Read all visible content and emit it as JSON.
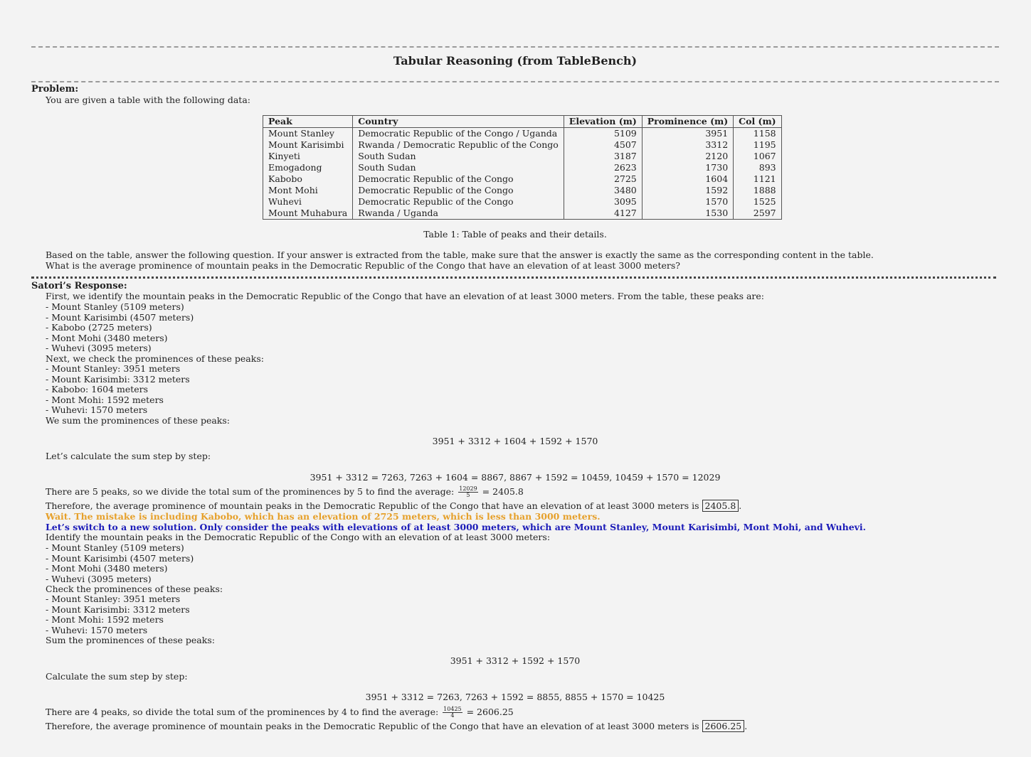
{
  "title": "Tabular Reasoning (from TableBench)",
  "problem": {
    "heading": "Problem:",
    "intro": "You are given a table with the following data:",
    "table": {
      "headers": [
        "Peak",
        "Country",
        "Elevation (m)",
        "Prominence (m)",
        "Col (m)"
      ],
      "rows": [
        [
          "Mount Stanley",
          "Democratic Republic of the Congo / Uganda",
          "5109",
          "3951",
          "1158"
        ],
        [
          "Mount Karisimbi",
          "Rwanda / Democratic Republic of the Congo",
          "4507",
          "3312",
          "1195"
        ],
        [
          "Kinyeti",
          "South Sudan",
          "3187",
          "2120",
          "1067"
        ],
        [
          "Emogadong",
          "South Sudan",
          "2623",
          "1730",
          "893"
        ],
        [
          "Kabobo",
          "Democratic Republic of the Congo",
          "2725",
          "1604",
          "1121"
        ],
        [
          "Mont Mohi",
          "Democratic Republic of the Congo",
          "3480",
          "1592",
          "1888"
        ],
        [
          "Wuhevi",
          "Democratic Republic of the Congo",
          "3095",
          "1570",
          "1525"
        ],
        [
          "Mount Muhabura",
          "Rwanda / Uganda",
          "4127",
          "1530",
          "2597"
        ]
      ],
      "caption": "Table 1: Table of peaks and their details."
    },
    "instruction": "Based on the table, answer the following question. If your answer is extracted from the table, make sure that the answer is exactly the same as the corresponding content in the table.",
    "question": "What is the average prominence of mountain peaks in the Democratic Republic of the Congo that have an elevation of at least 3000 meters?"
  },
  "response": {
    "heading": "Satori’s Response:",
    "first": "First, we identify the mountain peaks in the Democratic Republic of the Congo that have an elevation of at least 3000 meters. From the table, these peaks are:",
    "list1": [
      "- Mount Stanley (5109 meters)",
      "- Mount Karisimbi (4507 meters)",
      "- Kabobo (2725 meters)",
      "- Mont Mohi (3480 meters)",
      "- Wuhevi (3095 meters)"
    ],
    "next": "Next, we check the prominences of these peaks:",
    "list2": [
      "- Mount Stanley: 3951 meters",
      "- Mount Karisimbi: 3312 meters",
      "- Kabobo: 1604 meters",
      "- Mont Mohi: 1592 meters",
      "- Wuhevi: 1570 meters"
    ],
    "sum_intro": "We sum the prominences of these peaks:",
    "eq1": "3951 + 3312 + 1604 + 1592 + 1570",
    "step_intro": "Let’s calculate the sum step by step:",
    "eq2": "3951 + 3312 = 7263, 7263 + 1604 = 8867, 8867 + 1592 = 10459, 10459 + 1570 = 12029",
    "avg_text": "There are 5 peaks, so we divide the total sum of the prominences by 5 to find the average:",
    "avg_num": "12029",
    "avg_den": "5",
    "avg_result": "= 2405.8",
    "therefore1": "Therefore, the average prominence of mountain peaks in the Democratic Republic of the Congo that have an elevation of at least 3000 meters is",
    "answer1": "2405.8",
    "wait": "Wait. The mistake is including Kabobo, which has an elevation of 2725 meters, which is less than 3000 meters.",
    "switch": "Let’s switch to a new solution. Only consider the peaks with elevations of at least 3000 meters, which are Mount Stanley, Mount Karisimbi, Mont Mohi, and Wuhevi.",
    "identify": "Identify the mountain peaks in the Democratic Republic of the Congo with an elevation of at least 3000 meters:",
    "list3": [
      "- Mount Stanley (5109 meters)",
      "- Mount Karisimbi (4507 meters)",
      "- Mont Mohi (3480 meters)",
      "- Wuhevi (3095 meters)"
    ],
    "check": "Check the prominences of these peaks:",
    "list4": [
      "- Mount Stanley: 3951 meters",
      "- Mount Karisimbi: 3312 meters",
      "- Mont Mohi: 1592 meters",
      "- Wuhevi: 1570 meters"
    ],
    "sum2_intro": "Sum the prominences of these peaks:",
    "eq3": "3951 + 3312 + 1592 + 1570",
    "step2_intro": "Calculate the sum step by step:",
    "eq4": "3951 + 3312 = 7263, 7263 + 1592 = 8855, 8855 + 1570 = 10425",
    "avg2_text": "There are 4 peaks, so divide the total sum of the prominences by 4 to find the average:",
    "avg2_num": "10425",
    "avg2_den": "4",
    "avg2_result": "= 2606.25",
    "therefore2": "Therefore, the average prominence of mountain peaks in the Democratic Republic of the Congo that have an elevation of at least 3000 meters is",
    "answer2": "2606.25"
  }
}
